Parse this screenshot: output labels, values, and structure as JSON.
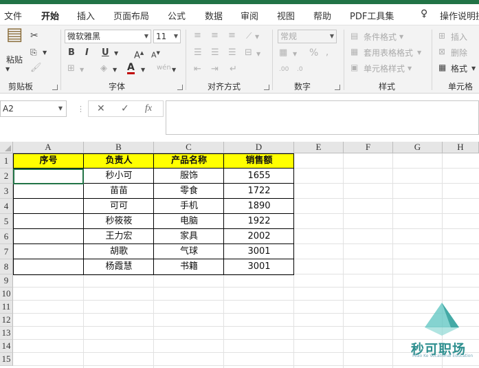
{
  "tabs": [
    {
      "label": "文件"
    },
    {
      "label": "开始"
    },
    {
      "label": "插入"
    },
    {
      "label": "页面布局"
    },
    {
      "label": "公式"
    },
    {
      "label": "数据"
    },
    {
      "label": "审阅"
    },
    {
      "label": "视图"
    },
    {
      "label": "帮助"
    },
    {
      "label": "PDF工具集"
    },
    {
      "label": "操作说明搜"
    }
  ],
  "ribbon": {
    "clipboard": {
      "label": "剪贴板",
      "paste_label": "粘贴"
    },
    "font": {
      "label": "字体",
      "font_name": "微软雅黑",
      "font_size": "11"
    },
    "alignment": {
      "label": "对齐方式"
    },
    "number": {
      "label": "数字",
      "format": "常规"
    },
    "styles": {
      "label": "样式",
      "conditional": "条件格式",
      "table_format": "套用表格格式",
      "cell_styles": "单元格样式"
    },
    "cells": {
      "label": "单元格",
      "insert": "插入",
      "delete": "删除",
      "format": "格式"
    }
  },
  "formula_bar": {
    "name_box": "A2",
    "formula": ""
  },
  "sheet": {
    "columns": [
      "A",
      "B",
      "C",
      "D",
      "E",
      "F",
      "G",
      "H"
    ],
    "rows": [
      "1",
      "2",
      "3",
      "4",
      "5",
      "6",
      "7",
      "8",
      "9",
      "10",
      "11",
      "12",
      "13",
      "14",
      "15"
    ],
    "headers": [
      "序号",
      "负责人",
      "产品名称",
      "销售额"
    ],
    "data": [
      [
        "",
        "秒小可",
        "服饰",
        "1655"
      ],
      [
        "",
        "苗苗",
        "零食",
        "1722"
      ],
      [
        "",
        "可可",
        "手机",
        "1890"
      ],
      [
        "",
        "秒筱筱",
        "电脑",
        "1922"
      ],
      [
        "",
        "王力宏",
        "家具",
        "2002"
      ],
      [
        "",
        "胡歌",
        "气球",
        "3001"
      ],
      [
        "",
        "杨霞慧",
        "书籍",
        "3001"
      ]
    ],
    "header_fill": "#ffff00",
    "selected_cell": "A2"
  },
  "watermark": {
    "logo_text": "秒可职场",
    "sub_text": "Miao Ke Vocational Education"
  },
  "colors": {
    "accent": "#217346",
    "font_color": "#c00000"
  }
}
